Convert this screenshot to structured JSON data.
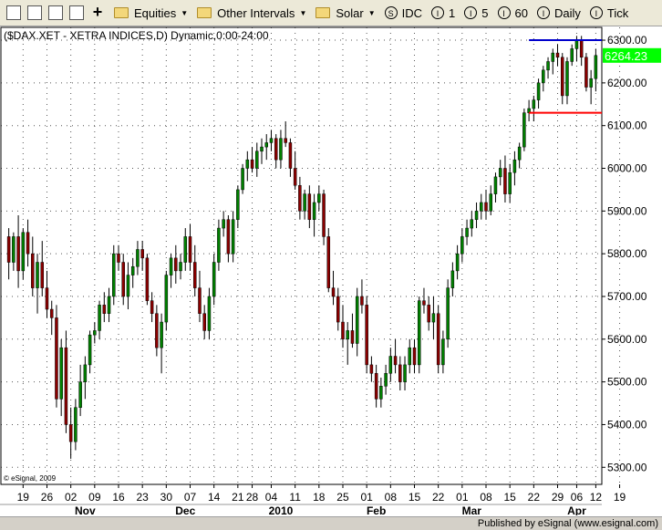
{
  "toolbar": {
    "icons": [
      "layout-icon",
      "copy-icon",
      "page-icon",
      "edit-icon",
      "add-icon"
    ],
    "equities_label": "Equities",
    "intervals_label": "Other Intervals",
    "solar_label": "Solar",
    "idc_symbol": "S",
    "idc_label": "IDC",
    "interval_1": "1",
    "interval_5": "5",
    "interval_60": "60",
    "daily_label": "Daily",
    "tick_label": "Tick",
    "interval_icon_symbol": "I"
  },
  "footer": {
    "copyright": "© eSignal, 2009",
    "published": "Published by eSignal (www.esignal.com)"
  },
  "chart_data": {
    "type": "candlestick",
    "title": "($DAX.XET - XETRA INDICES,D) Dynamic,0:00-24:00",
    "last_price": "6264.23",
    "last_price_value": 6264.23,
    "ylim": [
      5260,
      6330
    ],
    "yticks": [
      5300,
      5400,
      5500,
      5600,
      5700,
      5800,
      5900,
      6000,
      6100,
      6200,
      6300
    ],
    "ytick_labels": [
      "5300.00",
      "5400.00",
      "5500.00",
      "5600.00",
      "5700.00",
      "5800.00",
      "5900.00",
      "6000.00",
      "6100.00",
      "6200.00",
      "6300.00"
    ],
    "xtick_labels": [
      {
        "label": "19",
        "index": 3
      },
      {
        "label": "26",
        "index": 8
      },
      {
        "label": "02",
        "index": 13
      },
      {
        "label": "09",
        "index": 18
      },
      {
        "label": "16",
        "index": 23
      },
      {
        "label": "23",
        "index": 28
      },
      {
        "label": "30",
        "index": 33
      },
      {
        "label": "07",
        "index": 38
      },
      {
        "label": "14",
        "index": 43
      },
      {
        "label": "21",
        "index": 48
      },
      {
        "label": "28",
        "index": 51
      },
      {
        "label": "04",
        "index": 55
      },
      {
        "label": "11",
        "index": 60
      },
      {
        "label": "18",
        "index": 65
      },
      {
        "label": "25",
        "index": 70
      },
      {
        "label": "01",
        "index": 75
      },
      {
        "label": "08",
        "index": 80
      },
      {
        "label": "15",
        "index": 85
      },
      {
        "label": "22",
        "index": 90
      },
      {
        "label": "01",
        "index": 95
      },
      {
        "label": "08",
        "index": 100
      },
      {
        "label": "15",
        "index": 105
      },
      {
        "label": "22",
        "index": 110
      },
      {
        "label": "29",
        "index": 115
      },
      {
        "label": "06",
        "index": 119
      },
      {
        "label": "12",
        "index": 123
      },
      {
        "label": "19",
        "index": 128
      }
    ],
    "month_labels": [
      {
        "label": "Nov",
        "index": 16
      },
      {
        "label": "Dec",
        "index": 37
      },
      {
        "label": "2010",
        "index": 57
      },
      {
        "label": "Feb",
        "index": 77
      },
      {
        "label": "Mar",
        "index": 97
      },
      {
        "label": "Apr",
        "index": 119
      }
    ],
    "hlines": [
      {
        "value": 6300,
        "color": "#0000cc",
        "start_index": 109
      },
      {
        "value": 6130,
        "color": "#ff0000",
        "start_index": 109
      }
    ],
    "up_color": "#008000",
    "down_color": "#8b0000",
    "grid": true,
    "candles": [
      [
        5840,
        5860,
        5740,
        5780
      ],
      [
        5780,
        5850,
        5760,
        5840
      ],
      [
        5840,
        5890,
        5720,
        5760
      ],
      [
        5760,
        5860,
        5740,
        5850
      ],
      [
        5850,
        5880,
        5770,
        5800
      ],
      [
        5800,
        5840,
        5700,
        5720
      ],
      [
        5720,
        5800,
        5660,
        5780
      ],
      [
        5780,
        5830,
        5700,
        5720
      ],
      [
        5720,
        5760,
        5650,
        5670
      ],
      [
        5670,
        5690,
        5610,
        5650
      ],
      [
        5650,
        5680,
        5440,
        5460
      ],
      [
        5460,
        5600,
        5420,
        5580
      ],
      [
        5580,
        5620,
        5380,
        5400
      ],
      [
        5400,
        5440,
        5320,
        5360
      ],
      [
        5360,
        5460,
        5340,
        5440
      ],
      [
        5440,
        5540,
        5420,
        5500
      ],
      [
        5500,
        5560,
        5460,
        5540
      ],
      [
        5540,
        5620,
        5520,
        5610
      ],
      [
        5610,
        5640,
        5590,
        5620
      ],
      [
        5620,
        5690,
        5600,
        5680
      ],
      [
        5680,
        5710,
        5640,
        5660
      ],
      [
        5660,
        5720,
        5640,
        5700
      ],
      [
        5700,
        5820,
        5680,
        5800
      ],
      [
        5800,
        5820,
        5760,
        5780
      ],
      [
        5780,
        5800,
        5680,
        5700
      ],
      [
        5700,
        5780,
        5670,
        5750
      ],
      [
        5750,
        5790,
        5720,
        5770
      ],
      [
        5770,
        5830,
        5750,
        5810
      ],
      [
        5810,
        5830,
        5760,
        5790
      ],
      [
        5790,
        5800,
        5680,
        5690
      ],
      [
        5690,
        5710,
        5640,
        5660
      ],
      [
        5660,
        5680,
        5560,
        5580
      ],
      [
        5580,
        5660,
        5520,
        5640
      ],
      [
        5640,
        5760,
        5620,
        5750
      ],
      [
        5750,
        5800,
        5720,
        5790
      ],
      [
        5790,
        5820,
        5730,
        5760
      ],
      [
        5760,
        5800,
        5740,
        5780
      ],
      [
        5780,
        5860,
        5760,
        5840
      ],
      [
        5840,
        5870,
        5760,
        5780
      ],
      [
        5780,
        5820,
        5700,
        5720
      ],
      [
        5720,
        5760,
        5640,
        5660
      ],
      [
        5660,
        5680,
        5600,
        5620
      ],
      [
        5620,
        5720,
        5600,
        5700
      ],
      [
        5700,
        5800,
        5680,
        5780
      ],
      [
        5780,
        5880,
        5760,
        5860
      ],
      [
        5860,
        5900,
        5840,
        5880
      ],
      [
        5880,
        5890,
        5780,
        5800
      ],
      [
        5800,
        5900,
        5780,
        5880
      ],
      [
        5880,
        5960,
        5860,
        5950
      ],
      [
        5950,
        6010,
        5940,
        6000
      ],
      [
        6000,
        6040,
        5970,
        6020
      ],
      [
        6020,
        6050,
        5990,
        6000
      ],
      [
        6000,
        6060,
        5980,
        6040
      ],
      [
        6040,
        6070,
        6010,
        6050
      ],
      [
        6050,
        6080,
        6020,
        6060
      ],
      [
        6060,
        6090,
        6040,
        6070
      ],
      [
        6070,
        6080,
        6000,
        6020
      ],
      [
        6020,
        6090,
        6000,
        6070
      ],
      [
        6070,
        6110,
        6050,
        6060
      ],
      [
        6060,
        6070,
        5980,
        6000
      ],
      [
        6000,
        6040,
        5950,
        5960
      ],
      [
        5960,
        5980,
        5880,
        5900
      ],
      [
        5900,
        5950,
        5880,
        5940
      ],
      [
        5940,
        5960,
        5860,
        5880
      ],
      [
        5880,
        5940,
        5840,
        5920
      ],
      [
        5920,
        5960,
        5900,
        5940
      ],
      [
        5940,
        5950,
        5820,
        5840
      ],
      [
        5840,
        5860,
        5710,
        5720
      ],
      [
        5720,
        5760,
        5680,
        5700
      ],
      [
        5700,
        5720,
        5620,
        5640
      ],
      [
        5640,
        5680,
        5580,
        5600
      ],
      [
        5600,
        5640,
        5540,
        5620
      ],
      [
        5620,
        5660,
        5580,
        5590
      ],
      [
        5590,
        5720,
        5560,
        5700
      ],
      [
        5700,
        5740,
        5660,
        5680
      ],
      [
        5680,
        5700,
        5520,
        5540
      ],
      [
        5540,
        5560,
        5500,
        5520
      ],
      [
        5520,
        5540,
        5440,
        5460
      ],
      [
        5460,
        5510,
        5440,
        5490
      ],
      [
        5490,
        5540,
        5470,
        5520
      ],
      [
        5520,
        5580,
        5500,
        5560
      ],
      [
        5560,
        5600,
        5520,
        5540
      ],
      [
        5540,
        5560,
        5480,
        5500
      ],
      [
        5500,
        5560,
        5480,
        5540
      ],
      [
        5540,
        5600,
        5520,
        5580
      ],
      [
        5580,
        5600,
        5520,
        5540
      ],
      [
        5540,
        5700,
        5520,
        5690
      ],
      [
        5690,
        5720,
        5660,
        5680
      ],
      [
        5680,
        5700,
        5620,
        5640
      ],
      [
        5640,
        5700,
        5600,
        5660
      ],
      [
        5660,
        5680,
        5520,
        5540
      ],
      [
        5540,
        5620,
        5520,
        5600
      ],
      [
        5600,
        5740,
        5580,
        5720
      ],
      [
        5720,
        5780,
        5700,
        5760
      ],
      [
        5760,
        5820,
        5740,
        5800
      ],
      [
        5800,
        5860,
        5780,
        5840
      ],
      [
        5840,
        5880,
        5820,
        5860
      ],
      [
        5860,
        5900,
        5840,
        5880
      ],
      [
        5880,
        5920,
        5860,
        5900
      ],
      [
        5900,
        5940,
        5880,
        5920
      ],
      [
        5920,
        5950,
        5880,
        5900
      ],
      [
        5900,
        5960,
        5890,
        5940
      ],
      [
        5940,
        5990,
        5920,
        5980
      ],
      [
        5980,
        6020,
        5960,
        6000
      ],
      [
        6000,
        6030,
        5920,
        5940
      ],
      [
        5940,
        6010,
        5920,
        5990
      ],
      [
        5990,
        6040,
        5960,
        6020
      ],
      [
        6020,
        6060,
        6000,
        6050
      ],
      [
        6050,
        6140,
        6040,
        6130
      ],
      [
        6130,
        6160,
        6110,
        6140
      ],
      [
        6140,
        6170,
        6110,
        6160
      ],
      [
        6160,
        6210,
        6140,
        6200
      ],
      [
        6200,
        6240,
        6180,
        6230
      ],
      [
        6230,
        6260,
        6210,
        6250
      ],
      [
        6250,
        6280,
        6220,
        6270
      ],
      [
        6270,
        6290,
        6240,
        6260
      ],
      [
        6260,
        6270,
        6150,
        6170
      ],
      [
        6170,
        6260,
        6150,
        6250
      ],
      [
        6250,
        6290,
        6240,
        6280
      ],
      [
        6280,
        6310,
        6250,
        6300
      ],
      [
        6300,
        6310,
        6240,
        6260
      ],
      [
        6260,
        6270,
        6180,
        6190
      ],
      [
        6190,
        6230,
        6150,
        6210
      ],
      [
        6210,
        6280,
        6180,
        6264.23
      ]
    ]
  }
}
